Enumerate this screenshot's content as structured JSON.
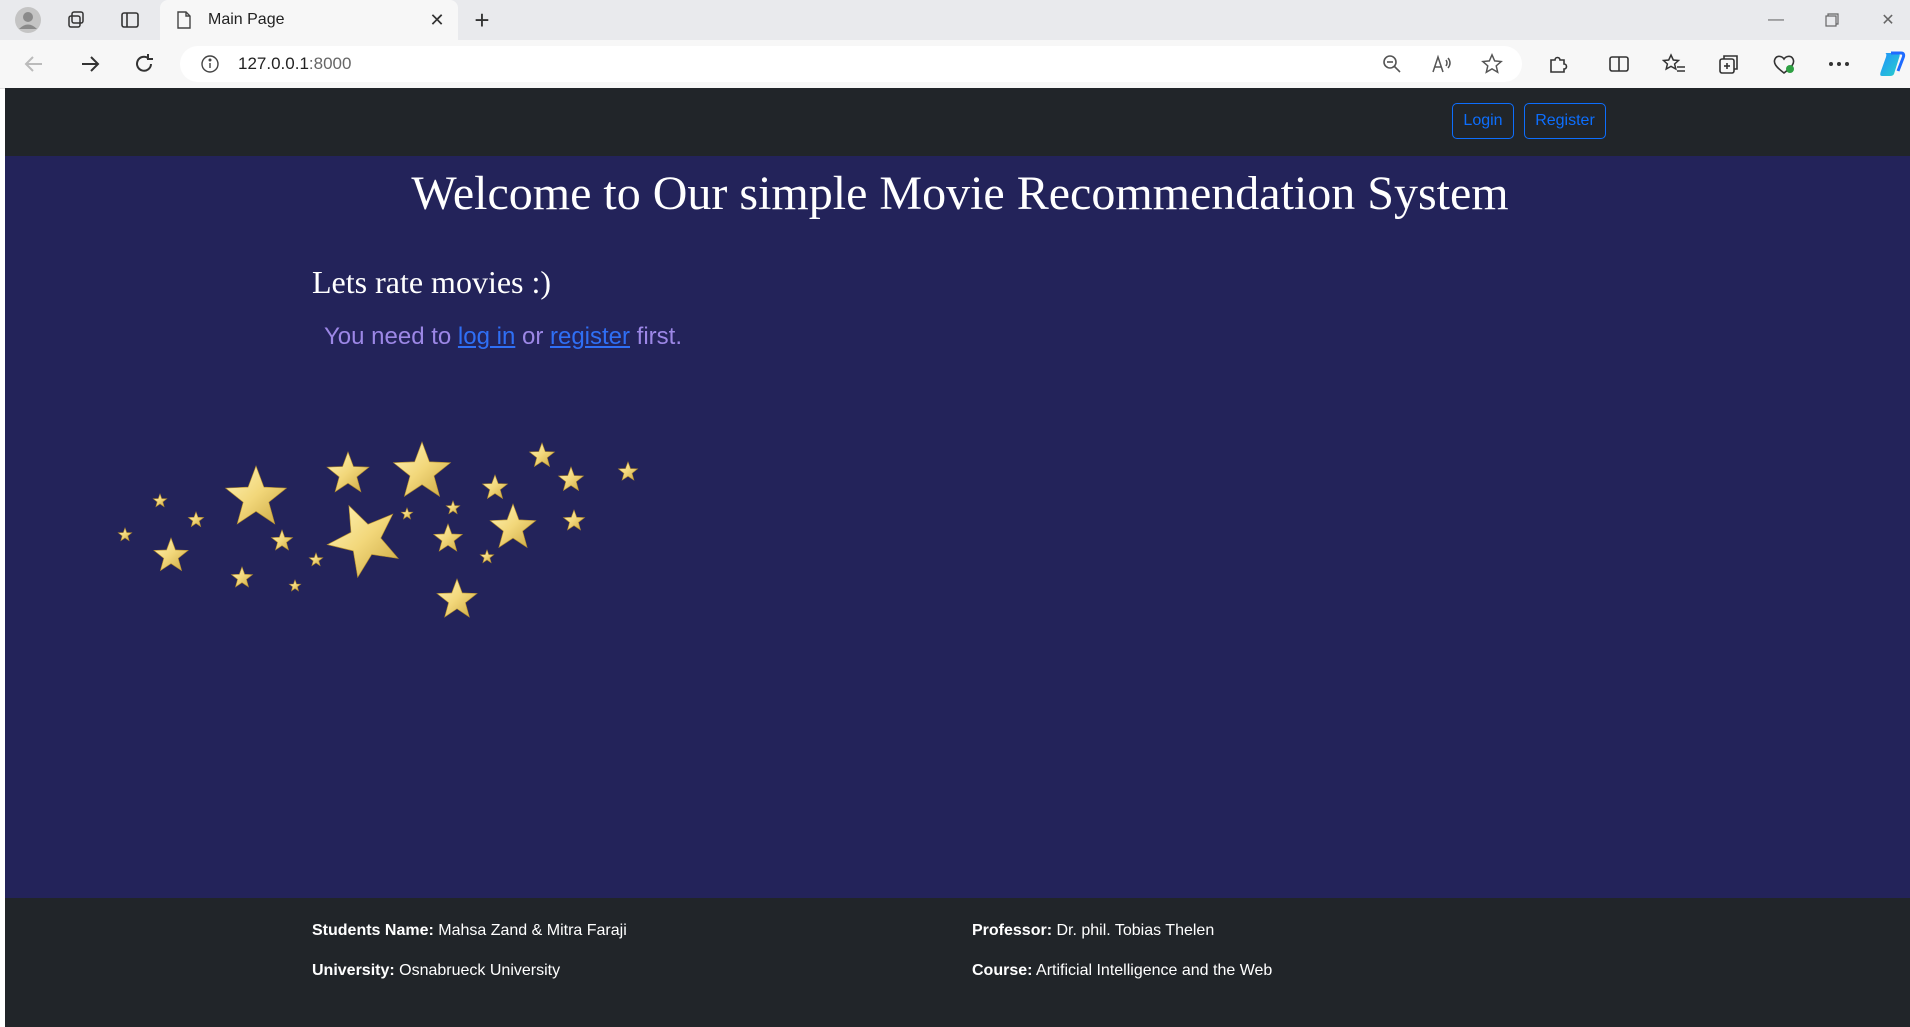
{
  "browser": {
    "tab_title": "Main Page",
    "url_host": "127.0.0.1",
    "url_port": ":8000"
  },
  "navbar": {
    "login_label": "Login",
    "register_label": "Register"
  },
  "main": {
    "title": "Welcome to Our simple Movie Recommendation System",
    "subtitle": "Lets rate movies :)",
    "notice_prefix": "You need to ",
    "notice_login_link": "log in",
    "notice_or": " or ",
    "notice_register_link": "register",
    "notice_suffix": " first."
  },
  "footer": {
    "students_label": "Students Name:",
    "students_value": "Mahsa Zand & Mitra Faraji",
    "university_label": "University:",
    "university_value": "Osnabrueck University",
    "professor_label": "Professor:",
    "professor_value": "Dr. phil. Tobias Thelen",
    "course_label": "Course:",
    "course_value": "Artificial Intelligence and the Web"
  },
  "colors": {
    "page_background": "#23235a",
    "dark_bar": "#212529",
    "link_blue": "#0d6efd",
    "notice_purple": "#9c87e6",
    "star_gold": "#f2d77a"
  },
  "icons": [
    "profile-icon",
    "workspaces-icon",
    "vertical-tabs-icon",
    "document-icon",
    "close-icon",
    "plus-icon",
    "minimize-icon",
    "restore-icon",
    "window-close-icon",
    "back-icon",
    "forward-icon",
    "refresh-icon",
    "info-icon",
    "zoom-out-icon",
    "read-aloud-icon",
    "favorite-star-icon",
    "extensions-icon",
    "split-screen-icon",
    "favorites-icon",
    "collections-icon",
    "browser-essentials-icon",
    "more-icon",
    "copilot-icon",
    "stars-decoration"
  ]
}
